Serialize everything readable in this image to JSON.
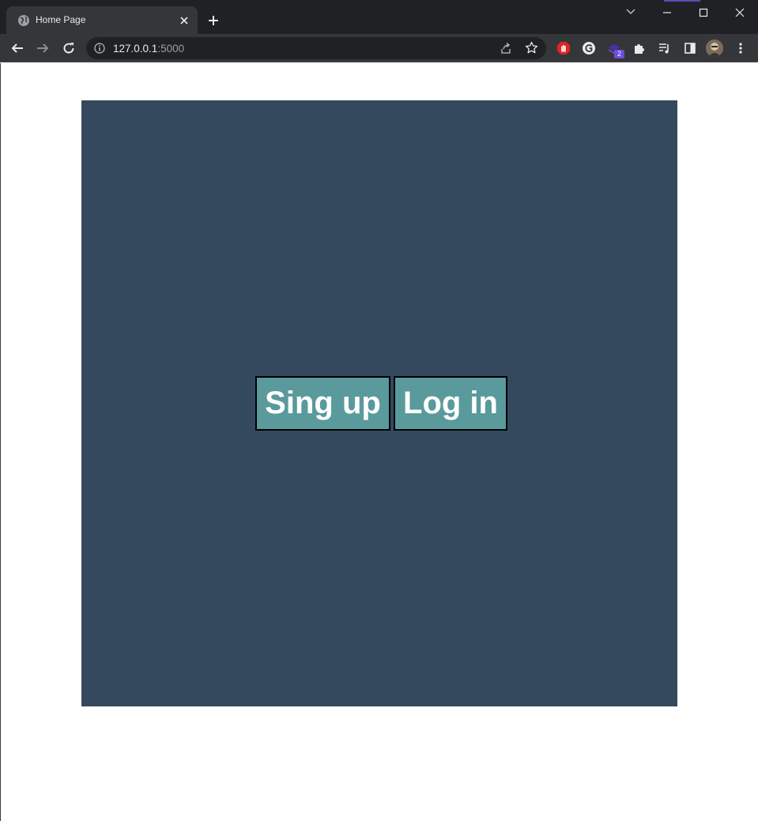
{
  "browser": {
    "tab": {
      "title": "Home Page",
      "icon": "globe-icon"
    },
    "address_bar": {
      "host": "127.0.0.1",
      "port": ":5000"
    },
    "extensions": {
      "badge_count": "2"
    }
  },
  "page": {
    "buttons": {
      "signup_label": "Sing up",
      "login_label": "Log in"
    }
  },
  "colors": {
    "panel_bg": "#35495e",
    "button_bg": "#5a9a9c",
    "button_text": "#ffffff",
    "chrome_dark": "#202124",
    "chrome_toolbar": "#35363a"
  }
}
